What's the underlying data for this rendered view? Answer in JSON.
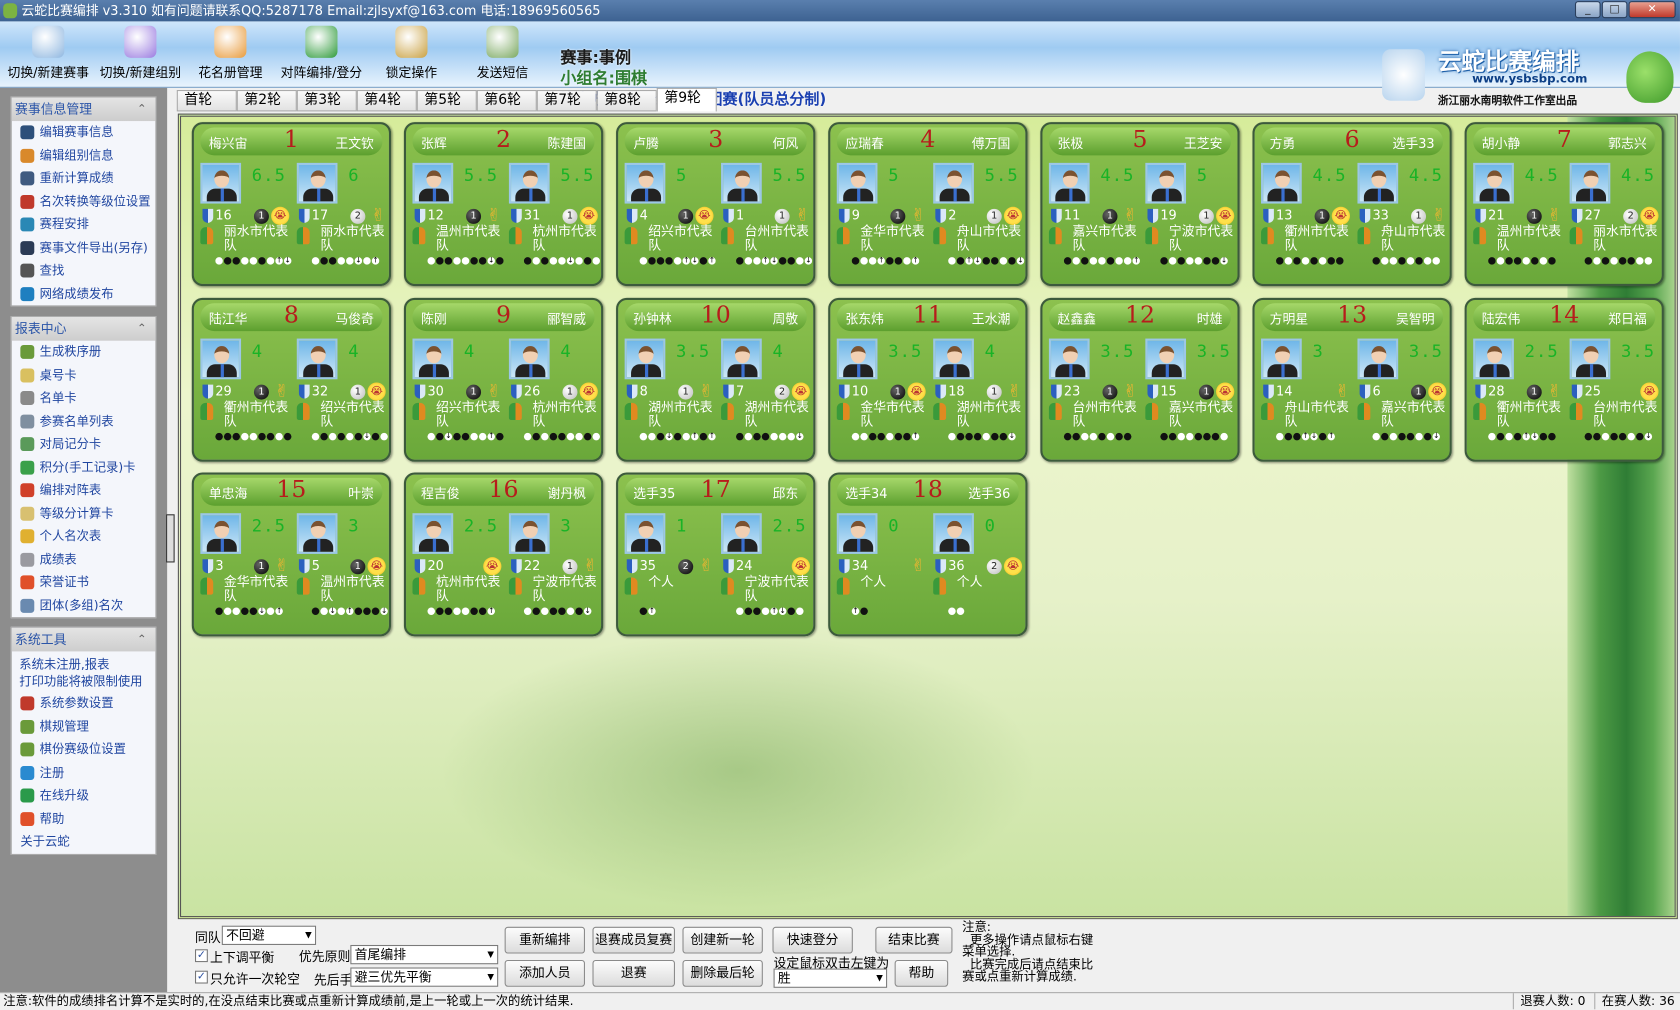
{
  "window": {
    "title": "云蛇比赛编排 v3.310  如有问题请联系QQ:5287178 Email:zjlsyxf@163.com 电话:18969560565",
    "controls": [
      "minimize",
      "maximize",
      "close"
    ]
  },
  "toolbar": {
    "items": [
      {
        "label": "切换/新建赛事",
        "icon": "calendar-icon",
        "color": "#8fb7e0"
      },
      {
        "label": "切换/新建组别",
        "icon": "groups-icon",
        "color": "#9a7be0"
      },
      {
        "label": "花名册管理",
        "icon": "people-icon",
        "color": "#e89a3a"
      },
      {
        "label": "对阵编排/登分",
        "icon": "vs-shield-icon",
        "color": "#2e9a3a"
      },
      {
        "label": "锁定操作",
        "icon": "keys-icon",
        "color": "#c9a040"
      },
      {
        "label": "发送短信",
        "icon": "envelope-icon",
        "color": "#7aa860"
      }
    ],
    "event": "赛事:事例",
    "group": "小组名:围棋",
    "method": "比赛方法:积分编排制-团赛(队员总分制)",
    "logo": {
      "title": "云蛇比赛编排",
      "url": "www.ysbsbp.com",
      "credit": "浙江丽水南明软件工作室出品"
    }
  },
  "sidebar": {
    "panels": [
      {
        "title": "赛事信息管理",
        "items": [
          {
            "label": "编辑赛事信息",
            "icon": "settings-icon",
            "color": "#2d4f7a"
          },
          {
            "label": "编辑组别信息",
            "icon": "user-edit-icon",
            "color": "#d9892b"
          },
          {
            "label": "重新计算成绩",
            "icon": "calculator-icon",
            "color": "#3f5a80"
          },
          {
            "label": "名次转换等级位设置",
            "icon": "blocks-icon",
            "color": "#c0392b"
          },
          {
            "label": "赛程安排",
            "icon": "clock-icon",
            "color": "#2a88b5"
          },
          {
            "label": "赛事文件导出(另存)",
            "icon": "save-icon",
            "color": "#2b3b55"
          },
          {
            "label": "查找",
            "icon": "binoculars-icon",
            "color": "#555555"
          },
          {
            "label": "网络成绩发布",
            "icon": "globe-icon",
            "color": "#1e7fc0"
          }
        ]
      },
      {
        "title": "报表中心",
        "items": [
          {
            "label": "生成秩序册",
            "icon": "puzzle-icon",
            "color": "#6a9a3a"
          },
          {
            "label": "桌号卡",
            "icon": "card-icon",
            "color": "#d9c060"
          },
          {
            "label": "名单卡",
            "icon": "list-card-icon",
            "color": "#8a8a8a"
          },
          {
            "label": "参赛名单列表",
            "icon": "document-icon",
            "color": "#7f8fa0"
          },
          {
            "label": "对局记分卡",
            "icon": "scorecard-icon",
            "color": "#5a9a5a"
          },
          {
            "label": "积分(手工记录)卡",
            "icon": "points-card-icon",
            "color": "#3aa04a"
          },
          {
            "label": "编排对阵表",
            "icon": "schedule-icon",
            "color": "#d0402a"
          },
          {
            "label": "等级分计算卡",
            "icon": "grid-icon",
            "color": "#d8c070"
          },
          {
            "label": "个人名次表",
            "icon": "badge-icon",
            "color": "#e0b030"
          },
          {
            "label": "成绩表",
            "icon": "score-icon",
            "color": "#9a9aa0"
          },
          {
            "label": "荣誉证书",
            "icon": "award-icon",
            "color": "#e0502a"
          },
          {
            "label": "团体(多组)名次",
            "icon": "team-rank-icon",
            "color": "#6a8ab0"
          }
        ]
      },
      {
        "title": "系统工具",
        "note": [
          "系统未注册,报表",
          "打印功能将被限制使用"
        ],
        "items": [
          {
            "label": "系统参数设置",
            "icon": "tools-icon",
            "color": "#c0392b"
          },
          {
            "label": "棋规管理",
            "icon": "puzzle-icon",
            "color": "#6a9a3a"
          },
          {
            "label": "棋份赛级位设置",
            "icon": "puzzle-icon",
            "color": "#6a9a3a"
          },
          {
            "label": "注册",
            "icon": "register-icon",
            "color": "#2a8ad0"
          },
          {
            "label": "在线升级",
            "icon": "update-icon",
            "color": "#2a9a4a"
          },
          {
            "label": "帮助",
            "icon": "lifebuoy-icon",
            "color": "#e0502a"
          },
          {
            "label": "关于云蛇",
            "icon": "",
            "color": ""
          }
        ]
      }
    ]
  },
  "tabs": {
    "items": [
      "首轮",
      "第2轮",
      "第3轮",
      "第4轮",
      "第5轮",
      "第6轮",
      "第7轮",
      "第8轮",
      "第9轮"
    ],
    "active": 8
  },
  "pairings": [
    {
      "table": "1",
      "left": {
        "name": "梅兴宙",
        "score": "6.5",
        "seed": "16",
        "ball": "b",
        "ball_num": "1",
        "result": "lose",
        "team": "丽水市代表队",
        "history": "wbbwwbwud"
      },
      "right": {
        "name": "王文钦",
        "score": "6",
        "seed": "17",
        "ball": "w",
        "ball_num": "2",
        "result": "win",
        "team": "丽水市代表队",
        "history": "wbbwwdwu"
      }
    },
    {
      "table": "2",
      "left": {
        "name": "张辉",
        "score": "5.5",
        "seed": "12",
        "ball": "b",
        "ball_num": "1",
        "result": "win",
        "team": "温州市代表队",
        "history": "wbbwwbbdb"
      },
      "right": {
        "name": "陈建国",
        "score": "5.5",
        "seed": "31",
        "ball": "w",
        "ball_num": "1",
        "result": "lose",
        "team": "杭州市代表队",
        "history": "bwbwwdwbw"
      }
    },
    {
      "table": "3",
      "left": {
        "name": "卢腾",
        "score": "5",
        "seed": "4",
        "ball": "b",
        "ball_num": "1",
        "result": "lose",
        "team": "绍兴市代表队",
        "history": "wbbbwudbu"
      },
      "right": {
        "name": "何风",
        "score": "5.5",
        "seed": "1",
        "ball": "w",
        "ball_num": "1",
        "result": "win",
        "team": "台州市代表队",
        "history": "bwwudbbwd"
      }
    },
    {
      "table": "4",
      "left": {
        "name": "应瑞春",
        "score": "5",
        "seed": "9",
        "ball": "b",
        "ball_num": "1",
        "result": "win",
        "team": "金华市代表队",
        "history": "bwwubbwu"
      },
      "right": {
        "name": "傅万国",
        "score": "5.5",
        "seed": "2",
        "ball": "w",
        "ball_num": "1",
        "result": "lose",
        "team": "舟山市代表队",
        "history": "wbudbbwbd"
      }
    },
    {
      "table": "5",
      "left": {
        "name": "张极",
        "score": "4.5",
        "seed": "11",
        "ball": "b",
        "ball_num": "1",
        "result": "win",
        "team": "嘉兴市代表队",
        "history": "bwbwwbwwu"
      },
      "right": {
        "name": "王芝安",
        "score": "5",
        "seed": "19",
        "ball": "w",
        "ball_num": "1",
        "result": "lose",
        "team": "宁波市代表队",
        "history": "bwbwwbbd"
      }
    },
    {
      "table": "6",
      "left": {
        "name": "方勇",
        "score": "4.5",
        "seed": "13",
        "ball": "b",
        "ball_num": "1",
        "result": "lose",
        "team": "衢州市代表队",
        "history": "bwbwbwbb"
      },
      "right": {
        "name": "选手33",
        "score": "4.5",
        "seed": "33",
        "ball": "w",
        "ball_num": "1",
        "result": "win",
        "team": "舟山市代表队",
        "history": "bwwbwbww"
      }
    },
    {
      "table": "7",
      "left": {
        "name": "胡小静",
        "score": "4.5",
        "seed": "21",
        "ball": "b",
        "ball_num": "1",
        "result": "win",
        "team": "温州市代表队",
        "history": "bwbbwbwb"
      },
      "right": {
        "name": "郭志兴",
        "score": "4.5",
        "seed": "27",
        "ball": "w",
        "ball_num": "2",
        "result": "lose",
        "team": "丽水市代表队",
        "history": "bwbwbbww"
      }
    },
    {
      "table": "8",
      "left": {
        "name": "陆江华",
        "score": "4",
        "seed": "29",
        "ball": "b",
        "ball_num": "1",
        "result": "win",
        "team": "衢州市代表队",
        "history": "bbbwwbbwb"
      },
      "right": {
        "name": "马俊奇",
        "score": "4",
        "seed": "32",
        "ball": "w",
        "ball_num": "1",
        "result": "lose",
        "team": "绍兴市代表队",
        "history": "wbwbwbdbw"
      }
    },
    {
      "table": "9",
      "left": {
        "name": "陈刚",
        "score": "4",
        "seed": "30",
        "ball": "b",
        "ball_num": "1",
        "result": "win",
        "team": "绍兴市代表队",
        "history": "wbdbbwwub"
      },
      "right": {
        "name": "郦智威",
        "score": "4",
        "seed": "26",
        "ball": "w",
        "ball_num": "1",
        "result": "lose",
        "team": "杭州市代表队",
        "history": "wbwbbwwbw"
      }
    },
    {
      "table": "10",
      "left": {
        "name": "孙钟林",
        "score": "3.5",
        "seed": "8",
        "ball": "w",
        "ball_num": "1",
        "result": "win",
        "team": "湖州市代表队",
        "history": "wwbdbwubu"
      },
      "right": {
        "name": "周敬",
        "score": "4",
        "seed": "7",
        "ball": "w",
        "ball_num": "2",
        "result": "lose",
        "team": "湖州市代表队",
        "history": "bwbbwwwd"
      }
    },
    {
      "table": "11",
      "left": {
        "name": "张东炜",
        "score": "3.5",
        "seed": "10",
        "ball": "b",
        "ball_num": "1",
        "result": "lose",
        "team": "金华市代表队",
        "history": "wwbbwbbu"
      },
      "right": {
        "name": "王水潮",
        "score": "4",
        "seed": "18",
        "ball": "w",
        "ball_num": "1",
        "result": "win",
        "team": "湖州市代表队",
        "history": "wbbbwbbd"
      }
    },
    {
      "table": "12",
      "left": {
        "name": "赵鑫鑫",
        "score": "3.5",
        "seed": "23",
        "ball": "b",
        "ball_num": "1",
        "result": "win",
        "team": "台州市代表队",
        "history": "bbwwbwbb"
      },
      "right": {
        "name": "时雄",
        "score": "3.5",
        "seed": "15",
        "ball": "b",
        "ball_num": "1",
        "result": "lose",
        "team": "嘉兴市代表队",
        "history": "bbwwbbbw"
      }
    },
    {
      "table": "13",
      "left": {
        "name": "方明星",
        "score": "3",
        "seed": "14",
        "ball": "",
        "ball_num": "",
        "result": "win",
        "team": "舟山市代表队",
        "history": "wbbudbu"
      },
      "right": {
        "name": "吴智明",
        "score": "3.5",
        "seed": "6",
        "ball": "b",
        "ball_num": "1",
        "result": "lose",
        "team": "嘉兴市代表队",
        "history": "wbwbbwbd"
      }
    },
    {
      "table": "14",
      "left": {
        "name": "陆宏伟",
        "score": "2.5",
        "seed": "28",
        "ball": "b",
        "ball_num": "1",
        "result": "win",
        "team": "衢州市代表队",
        "history": "wbwbudbb"
      },
      "right": {
        "name": "郑日福",
        "score": "3.5",
        "seed": "25",
        "ball": "",
        "ball_num": "",
        "result": "lose",
        "team": "台州市代表队",
        "history": "bbwbbwbd"
      }
    },
    {
      "table": "15",
      "left": {
        "name": "单忠海",
        "score": "2.5",
        "seed": "3",
        "ball": "b",
        "ball_num": "1",
        "result": "win",
        "team": "金华市代表队",
        "history": "bwwbbdwu"
      },
      "right": {
        "name": "叶崇",
        "score": "3",
        "seed": "5",
        "ball": "b",
        "ball_num": "1",
        "result": "lose",
        "team": "温州市代表队",
        "history": "bwdwubbbd"
      }
    },
    {
      "table": "16",
      "left": {
        "name": "程吉俊",
        "score": "2.5",
        "seed": "20",
        "ball": "",
        "ball_num": "",
        "result": "lose",
        "team": "杭州市代表队",
        "history": "wbbwwbbu"
      },
      "right": {
        "name": "谢丹枫",
        "score": "3",
        "seed": "22",
        "ball": "w",
        "ball_num": "1",
        "result": "win",
        "team": "宁波市代表队",
        "history": "wbwbbwbd"
      }
    },
    {
      "table": "17",
      "left": {
        "name": "选手35",
        "score": "1",
        "seed": "35",
        "ball": "b",
        "ball_num": "2",
        "result": "win",
        "team": "个人",
        "history": "bu"
      },
      "right": {
        "name": "邱东",
        "score": "2.5",
        "seed": "24",
        "ball": "",
        "ball_num": "",
        "result": "lose",
        "team": "宁波市代表队",
        "history": "wbbwudbw"
      }
    },
    {
      "table": "18",
      "left": {
        "name": "选手34",
        "score": "0",
        "seed": "34",
        "ball": "",
        "ball_num": "",
        "result": "win",
        "team": "个人",
        "history": "ub"
      },
      "right": {
        "name": "选手36",
        "score": "0",
        "seed": "36",
        "ball": "w",
        "ball_num": "2",
        "result": "lose",
        "team": "个人",
        "history": "ww"
      }
    }
  ],
  "controls": {
    "same_team_label": "同队",
    "same_team_value": "不回避",
    "balance_label": "上下调平衡",
    "balance_checked": true,
    "bye_label": "只允许一次轮空",
    "bye_checked": true,
    "priority_label": "优先原则",
    "priority_value": "首尾编排",
    "color_label": "先后手",
    "color_value": "避三优先平衡",
    "buttons": {
      "repair": "重新编排",
      "rejoin": "退赛成员复赛",
      "new_round": "创建新一轮",
      "quick_score": "快速登分",
      "end": "结束比赛",
      "add": "添加人员",
      "withdraw": "退赛",
      "delete_last": "删除最后轮",
      "help": "帮助"
    },
    "dblclick_label": "设定鼠标双击左键为",
    "dblclick_value": "胜",
    "note_lines": [
      "注意:",
      "  更多操作请点鼠标右键",
      "菜单选择.",
      "  比赛完成后请点结束比",
      "赛或点重新计算成绩."
    ]
  },
  "status": {
    "message": "注意:软件的成绩排名计算不是实时的,在没点结束比赛或点重新计算成绩前,是上一轮或上一次的统计结果.",
    "withdrawn": "退赛人数: 0",
    "active": "在赛人数: 36"
  }
}
